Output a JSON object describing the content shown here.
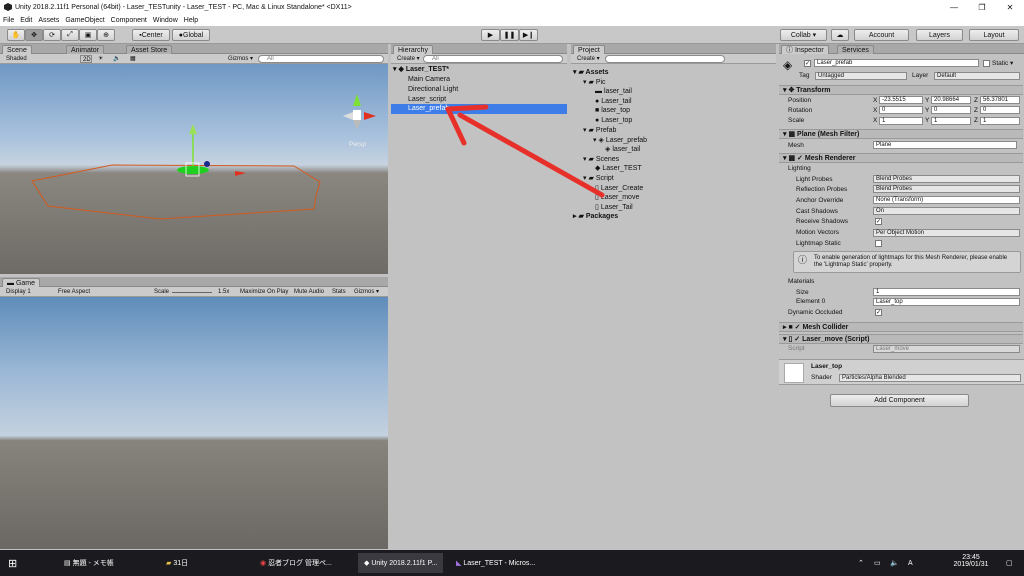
{
  "window": {
    "title": "Unity 2018.2.11f1 Personal (64bit) - Laser_TESTunity - Laser_TEST - PC, Mac & Linux Standalone* <DX11>"
  },
  "menu": [
    "File",
    "Edit",
    "Assets",
    "GameObject",
    "Component",
    "Window",
    "Help"
  ],
  "toolbar": {
    "center": "Center",
    "global": "Global",
    "collab": "Collab ▾",
    "account": "Account",
    "layers": "Layers",
    "layout": "Layout"
  },
  "scene": {
    "tab_scene": "Scene",
    "tab_animator": "Animator",
    "tab_asset_store": "Asset Store",
    "shaded": "Shaded",
    "mode_2d": "2D",
    "gizmos": "Gizmos ▾",
    "search": "All",
    "persp": "Persp"
  },
  "game": {
    "tab": "Game",
    "display": "Display 1",
    "aspect": "Free Aspect",
    "scale_label": "Scale",
    "scale_value": "1.5x",
    "max_on_play": "Maximize On Play",
    "mute": "Mute Audio",
    "stats": "Stats",
    "gizmos": "Gizmos ▾"
  },
  "hierarchy": {
    "tab": "Hierarchy",
    "create": "Create ▾",
    "search": "All",
    "scene": "Laser_TEST*",
    "items": [
      "Main Camera",
      "Directional Light",
      "Laser_script",
      "Laser_prefab"
    ]
  },
  "project": {
    "tab": "Project",
    "create": "Create ▾",
    "assets": "Assets",
    "pic": "Pic",
    "pic_items": [
      "laser_tail",
      "Laser_tail",
      "laser_top",
      "Laser_top"
    ],
    "prefab": "Prefab",
    "prefab_items": [
      "Laser_prefab",
      "laser_tail"
    ],
    "scenes": "Scenes",
    "scene_items": [
      "Laser_TEST"
    ],
    "script": "Script",
    "script_items": [
      "Laser_Create",
      "Laser_move",
      "Laser_Tail"
    ],
    "packages": "Packages"
  },
  "inspector": {
    "tab": "Inspector",
    "services": "Services",
    "name": "Laser_prefab",
    "static": "Static ▾",
    "tag_label": "Tag",
    "tag": "Untagged",
    "layer_label": "Layer",
    "layer": "Default",
    "transform": {
      "title": "Transform",
      "position": [
        "Position",
        "-23.5515",
        "20.98664",
        "56.37801"
      ],
      "rotation": [
        "Rotation",
        "0",
        "0",
        "0"
      ],
      "scale": [
        "Scale",
        "1",
        "1",
        "1"
      ],
      "x": "X",
      "y": "Y",
      "z": "Z"
    },
    "mesh_filter": {
      "title": "Plane (Mesh Filter)",
      "mesh_label": "Mesh",
      "mesh": "Plane"
    },
    "mesh_renderer": {
      "title": "Mesh Renderer",
      "lighting": "Lighting",
      "light_probes_label": "Light Probes",
      "light_probes": "Blend Probes",
      "reflection_label": "Reflection Probes",
      "reflection": "Blend Probes",
      "anchor_label": "Anchor Override",
      "anchor": "None (Transform)",
      "cast_label": "Cast Shadows",
      "cast": "On",
      "receive_label": "Receive Shadows",
      "motion_label": "Motion Vectors",
      "motion": "Per Object Motion",
      "lightmap_label": "Lightmap Static",
      "info": "To enable generation of lightmaps for this Mesh Renderer, please enable the 'Lightmap Static' property.",
      "materials": "Materials",
      "size_label": "Size",
      "size": "1",
      "element_label": "Element 0",
      "element": "Laser_top",
      "dynamic_label": "Dynamic Occluded"
    },
    "mesh_collider": {
      "title": "Mesh Collider"
    },
    "laser_move": {
      "title": "Laser_move (Script)",
      "script_label": "Script",
      "script": "Laser_move"
    },
    "material": {
      "name": "Laser_top",
      "shader_label": "Shader",
      "shader": "Particles/Alpha Blended"
    },
    "add_component": "Add Component"
  },
  "taskbar": {
    "items": [
      "無題 - メモ帳",
      "31日",
      "忍者ブログ 管理ペ...",
      "Unity 2018.2.11f1 P...",
      "Laser_TEST - Micros..."
    ],
    "time": "23:45",
    "date": "2019/01/31"
  },
  "colors": {
    "selection": "#3e7de7",
    "arrow": "#e8302a",
    "taskbar": "#1b1b1f"
  }
}
